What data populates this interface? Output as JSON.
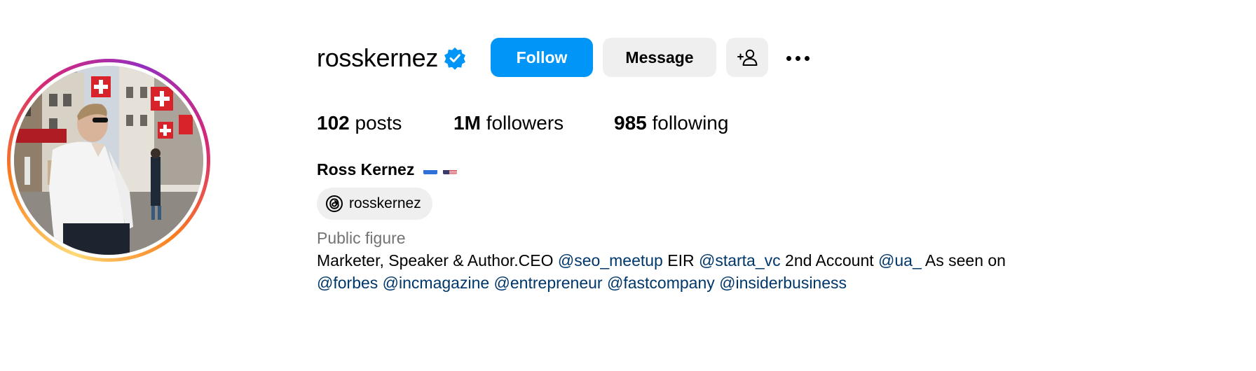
{
  "profile": {
    "username": "rosskernez",
    "full_name": "Ross Kernez",
    "flags": [
      "ukraine-flag",
      "usa-flag"
    ],
    "category": "Public figure",
    "threads_handle": "rosskernez"
  },
  "actions": {
    "follow_label": "Follow",
    "message_label": "Message"
  },
  "stats": {
    "posts_count": "102",
    "posts_label": "posts",
    "followers_count": "1M",
    "followers_label": "followers",
    "following_count": "985",
    "following_label": "following"
  },
  "bio": {
    "t1": "Marketer, Speaker & Author.CEO ",
    "m1": "@seo_meetup",
    "t2": " EIR ",
    "m2": "@starta_vc",
    "t3": " 2nd Account ",
    "m3": "@ua_",
    "t4": " As seen on ",
    "m4": "@forbes",
    "m5": "@incmagazine",
    "m6": "@entrepreneur",
    "m7": "@fastcompany",
    "m8": "@insiderbusiness"
  },
  "icons": {
    "verified": "verified-badge-icon",
    "add_user": "add-person-icon",
    "more": "more-options-icon",
    "threads": "threads-logo-icon"
  },
  "colors": {
    "follow_button": "#0095f6",
    "secondary_button": "#efefef",
    "mention": "#00376b",
    "category": "#737373",
    "verified": "#0095f6"
  }
}
